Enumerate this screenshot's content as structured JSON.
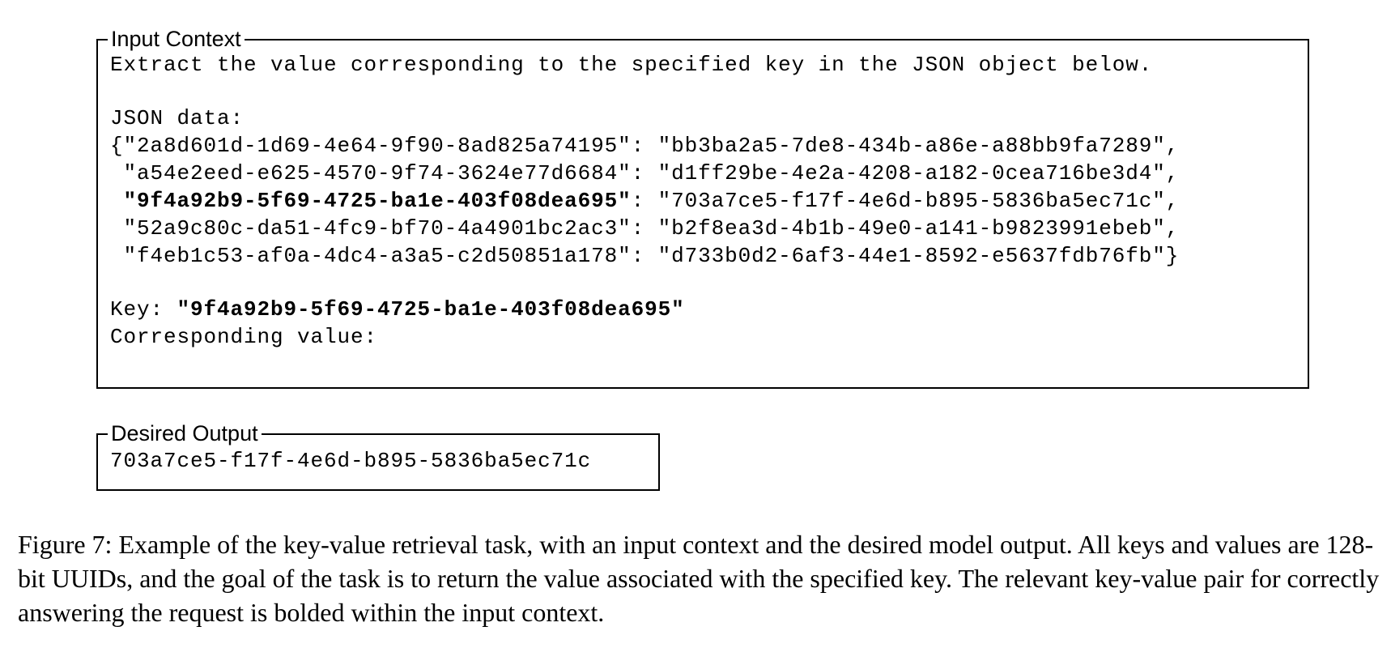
{
  "input_context": {
    "label": "Input Context",
    "instruction": "Extract the value corresponding to the specified key in the JSON object below.",
    "json_header": "JSON data:",
    "pairs": [
      {
        "prefix": "{\"",
        "key": "2a8d601d-1d69-4e64-9f90-8ad825a74195",
        "value": "bb3ba2a5-7de8-434b-a86e-a88bb9fa7289",
        "suffix": ","
      },
      {
        "prefix": " \"",
        "key": "a54e2eed-e625-4570-9f74-3624e77d6684",
        "value": "d1ff29be-4e2a-4208-a182-0cea716be3d4",
        "suffix": ","
      },
      {
        "prefix": " \"",
        "key": "9f4a92b9-5f69-4725-ba1e-403f08dea695",
        "value": "703a7ce5-f17f-4e6d-b895-5836ba5ec71c",
        "suffix": ","
      },
      {
        "prefix": " \"",
        "key": "52a9c80c-da51-4fc9-bf70-4a4901bc2ac3",
        "value": "b2f8ea3d-4b1b-49e0-a141-b9823991ebeb",
        "suffix": ","
      },
      {
        "prefix": " \"",
        "key": "f4eb1c53-af0a-4dc4-a3a5-c2d50851a178",
        "value": "d733b0d2-6af3-44e1-8592-e5637fdb76fb",
        "suffix": "}"
      }
    ],
    "key_label": "Key: ",
    "key_value": "\"9f4a92b9-5f69-4725-ba1e-403f08dea695\"",
    "answer_label": "Corresponding value:"
  },
  "desired_output": {
    "label": "Desired Output",
    "value": "703a7ce5-f17f-4e6d-b895-5836ba5ec71c"
  },
  "caption": "Figure 7: Example of the key-value retrieval task, with an input context and the desired model output. All keys and values are 128-bit UUIDs, and the goal of the task is to return the value associated with the specified key. The relevant key-value pair for correctly answering the request is bolded within the input context."
}
